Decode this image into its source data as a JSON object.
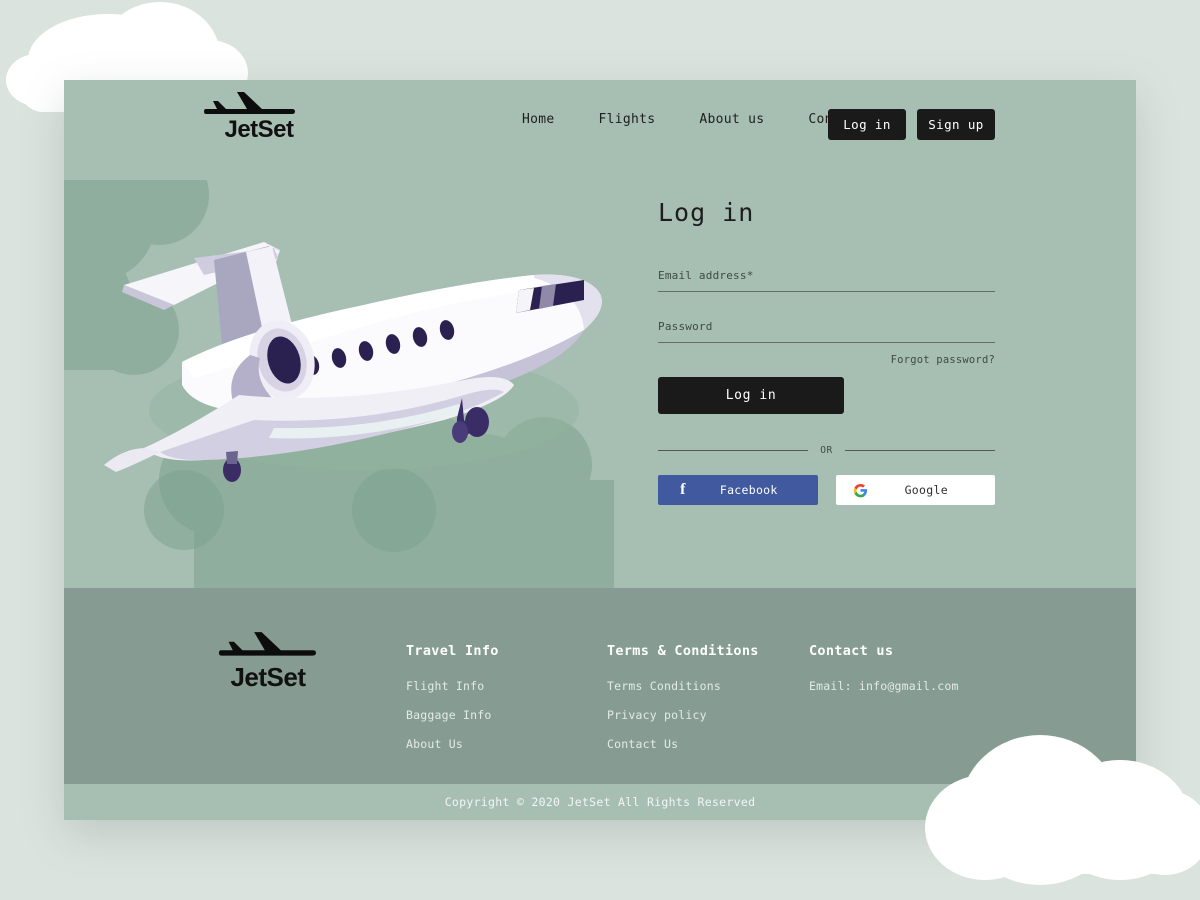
{
  "brand": {
    "name": "JetSet",
    "logo_icon": "airplane-icon"
  },
  "nav": {
    "links": [
      {
        "label": "Home"
      },
      {
        "label": "Flights"
      },
      {
        "label": "About us"
      },
      {
        "label": "Contact us"
      }
    ],
    "login_label": "Log in",
    "signup_label": "Sign up"
  },
  "login": {
    "title": "Log in",
    "email_label": "Email address*",
    "email_value": "",
    "email_placeholder": "Email address*",
    "password_label": "Password",
    "password_value": "",
    "password_placeholder": "Password",
    "forgot_label": "Forgot password?",
    "submit_label": "Log in",
    "or_label": "OR",
    "facebook_label": "Facebook",
    "facebook_icon": "facebook-icon",
    "google_label": "Google",
    "google_icon": "google-icon"
  },
  "footer": {
    "social": [
      {
        "name": "facebook-icon"
      },
      {
        "name": "instagram-icon"
      },
      {
        "name": "google-icon"
      }
    ],
    "columns": [
      {
        "heading": "Travel Info",
        "links": [
          {
            "label": "Flight Info"
          },
          {
            "label": "Baggage Info"
          },
          {
            "label": "About Us"
          }
        ]
      },
      {
        "heading": "Terms & Conditions",
        "links": [
          {
            "label": "Terms Conditions"
          },
          {
            "label": "Privacy policy"
          },
          {
            "label": "Contact Us"
          }
        ]
      },
      {
        "heading": "Contact us",
        "links": [
          {
            "label": "Email: info@gmail.com"
          }
        ]
      }
    ],
    "copyright": "Copyright © 2020 JetSet All Rights Reserved"
  },
  "colors": {
    "page_background": "#dbe3de",
    "hero_background": "#a6bfb2",
    "footer_background": "#869c92",
    "copyright_background": "#a6bfb2",
    "button_dark": "#1a1a1a",
    "facebook_blue": "#41599e",
    "google_white": "#ffffff"
  }
}
